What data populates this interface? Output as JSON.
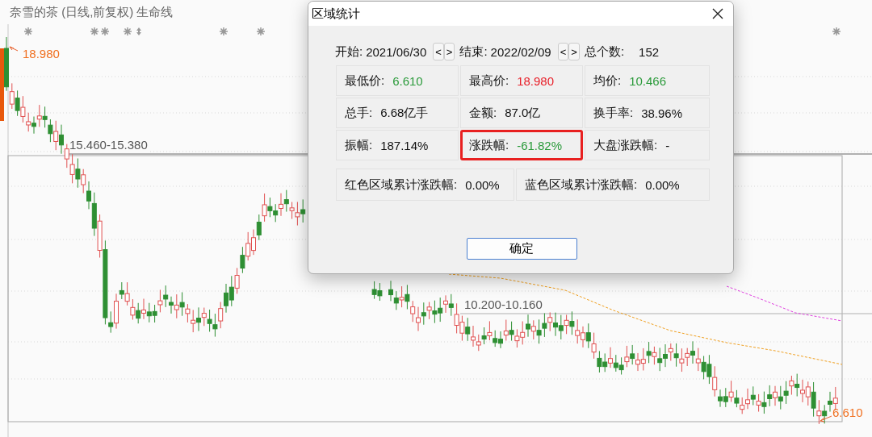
{
  "chart_header": {
    "title": "奈雪的茶 (日线,前复权) 生命线"
  },
  "chart_labels": [
    {
      "text": "18.980",
      "kind": "high"
    },
    {
      "text": "15.460-15.380",
      "kind": "level"
    },
    {
      "text": "10.200-10.160",
      "kind": "level"
    },
    {
      "text": "6.610",
      "kind": "low"
    }
  ],
  "dialog": {
    "title": "区域统计",
    "start_label": "开始:",
    "start_date": "2021/06/30",
    "start_buttons": [
      "<",
      ">"
    ],
    "end_label": "结束:",
    "end_date": "2022/02/09",
    "end_buttons": [
      "<",
      ">"
    ],
    "count_label": "总个数:",
    "count": "152",
    "stats": [
      {
        "label": "最低价:",
        "value": "6.610",
        "color": "#2a9a3a",
        "highlighted": false
      },
      {
        "label": "最高价:",
        "value": "18.980",
        "color": "#e8202a",
        "highlighted": false
      },
      {
        "label": "均价:",
        "value": "10.466",
        "color": "#2a9a3a",
        "highlighted": false
      },
      {
        "label": "总手:",
        "value": "6.68亿手",
        "color": "#111111",
        "highlighted": false
      },
      {
        "label": "金额:",
        "value": "87.0亿",
        "color": "#111111",
        "highlighted": false
      },
      {
        "label": "换手率:",
        "value": "38.96%",
        "color": "#111111",
        "highlighted": false
      },
      {
        "label": "振幅:",
        "value": "187.14%",
        "color": "#111111",
        "highlighted": false
      },
      {
        "label": "涨跌幅:",
        "value": "-61.82%",
        "color": "#2a9a3a",
        "highlighted": true
      },
      {
        "label": "大盘涨跌幅:",
        "value": "-",
        "color": "#111111",
        "highlighted": false
      }
    ],
    "totals": [
      {
        "label": "红色区域累计涨跌幅:",
        "value": "0.00%"
      },
      {
        "label": "蓝色区域累计涨跌幅:",
        "value": "0.00%"
      }
    ],
    "ok_button": "确定"
  }
}
